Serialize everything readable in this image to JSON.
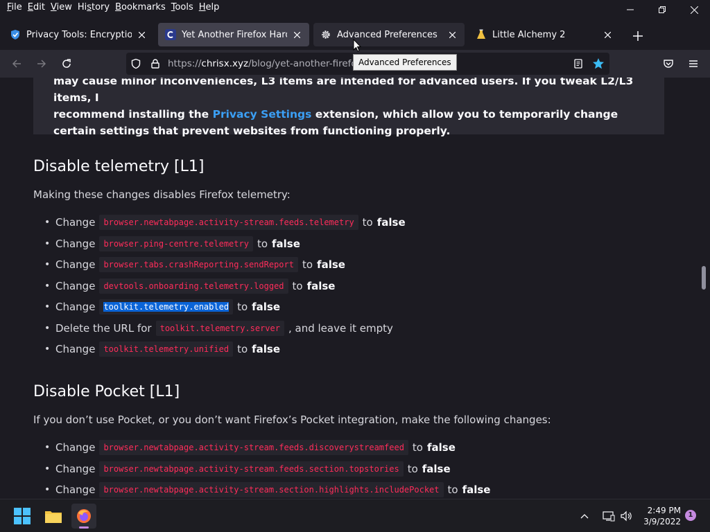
{
  "menubar": {
    "items": [
      {
        "pre": "",
        "u": "F",
        "post": "ile"
      },
      {
        "pre": "",
        "u": "E",
        "post": "dit"
      },
      {
        "pre": "",
        "u": "V",
        "post": "iew"
      },
      {
        "pre": "Hi",
        "u": "s",
        "post": "tory"
      },
      {
        "pre": "",
        "u": "B",
        "post": "ookmarks"
      },
      {
        "pre": "",
        "u": "T",
        "post": "ools"
      },
      {
        "pre": "",
        "u": "H",
        "post": "elp"
      }
    ]
  },
  "tabs": [
    {
      "title": "Privacy Tools: Encryption Against",
      "icon": "privacytools-shield-icon"
    },
    {
      "title": "Yet Another Firefox Hardening Guide",
      "icon": "chrisx-c-icon"
    },
    {
      "title": "Advanced Preferences",
      "icon": "gear-icon"
    },
    {
      "title": "Little Alchemy 2",
      "icon": "flask-icon"
    }
  ],
  "tooltip": "Advanced Preferences",
  "url": {
    "prefix": "https://",
    "domain": "chrisx.xyz",
    "path": "/blog/yet-another-firefox-hardening-guide/"
  },
  "content": {
    "note": {
      "line1": "may cause minor inconveniences, L3 items are intended for advanced users. If you tweak L2/L3 items, I",
      "before_link": "recommend installing the ",
      "link": "Privacy Settings",
      "after_link": " extension, which allow you to temporarily change certain settings that prevent websites from functioning properly."
    },
    "telemetry": {
      "heading": "Disable telemetry [L1]",
      "intro": "Making these changes disables Firefox telemetry:",
      "items": [
        {
          "prefix": "Change",
          "code": "browser.newtabpage.activity-stream.feeds.telemetry",
          "middle": "to",
          "value": "false",
          "selected": false
        },
        {
          "prefix": "Change",
          "code": "browser.ping-centre.telemetry",
          "middle": "to",
          "value": "false",
          "selected": false
        },
        {
          "prefix": "Change",
          "code": "browser.tabs.crashReporting.sendReport",
          "middle": "to",
          "value": "false",
          "selected": false
        },
        {
          "prefix": "Change",
          "code": "devtools.onboarding.telemetry.logged",
          "middle": "to",
          "value": "false",
          "selected": false
        },
        {
          "prefix": "Change",
          "code": "toolkit.telemetry.enabled",
          "middle": "to",
          "value": "false",
          "selected": true
        },
        {
          "prefix": "Delete the URL for",
          "code": "toolkit.telemetry.server",
          "middle": ", and leave it empty",
          "value": "",
          "selected": false
        },
        {
          "prefix": "Change",
          "code": "toolkit.telemetry.unified",
          "middle": "to",
          "value": "false",
          "selected": false
        }
      ]
    },
    "pocket": {
      "heading": "Disable Pocket [L1]",
      "intro": "If you don’t use Pocket, or you don’t want Firefox’s Pocket integration, make the following changes:",
      "items": [
        {
          "prefix": "Change",
          "code": "browser.newtabpage.activity-stream.feeds.discoverystreamfeed",
          "middle": "to",
          "value": "false",
          "selected": false
        },
        {
          "prefix": "Change",
          "code": "browser.newtabpage.activity-stream.feeds.section.topstories",
          "middle": "to",
          "value": "false",
          "selected": false
        },
        {
          "prefix": "Change",
          "code": "browser.newtabpage.activity-stream.section.highlights.includePocket",
          "middle": "to",
          "value": "false",
          "selected": false
        }
      ]
    }
  },
  "taskbar": {
    "time": "2:49 PM",
    "date": "3/9/2022",
    "notification_count": "1"
  },
  "colors": {
    "code_text": "#ff2c5a",
    "link": "#3b9ff5",
    "selection": "#0a64d7",
    "star": "#3bbcf5"
  }
}
